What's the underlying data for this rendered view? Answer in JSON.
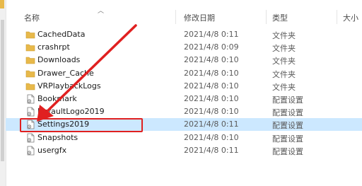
{
  "header": {
    "name": "名称",
    "modified": "修改日期",
    "type": "类型",
    "size": "大小"
  },
  "files": [
    {
      "name": "CachedData",
      "date": "2021/4/8 0:11",
      "type": "文件夹",
      "icon": "folder-icon"
    },
    {
      "name": "crashrpt",
      "date": "2021/4/8 0:09",
      "type": "文件夹",
      "icon": "folder-icon"
    },
    {
      "name": "Downloads",
      "date": "2021/4/8 0:10",
      "type": "文件夹",
      "icon": "folder-icon"
    },
    {
      "name": "Drawer_Cache",
      "date": "2021/4/8 0:10",
      "type": "文件夹",
      "icon": "folder-icon"
    },
    {
      "name": "VRPlaybackLogs",
      "date": "2021/4/8 0:10",
      "type": "文件夹",
      "icon": "folder-icon"
    },
    {
      "name": "Bookmark",
      "date": "2021/4/8 0:10",
      "type": "配置设置",
      "icon": "settings-file-icon"
    },
    {
      "name": "DefaultLogo2019",
      "date": "2021/4/8 0:10",
      "type": "配置设置",
      "icon": "settings-file-icon"
    },
    {
      "name": "Settings2019",
      "date": "2021/4/8 0:11",
      "type": "配置设置",
      "icon": "settings-file-icon",
      "selected": true
    },
    {
      "name": "Snapshots",
      "date": "2021/4/8 0:10",
      "type": "配置设置",
      "icon": "settings-file-icon"
    },
    {
      "name": "usergfx",
      "date": "2021/4/8 0:11",
      "type": "配置设置",
      "icon": "settings-file-icon"
    }
  ],
  "colors": {
    "selection": "#cce8ff",
    "annotation": "#e02020",
    "folder": "#e8b94a"
  }
}
